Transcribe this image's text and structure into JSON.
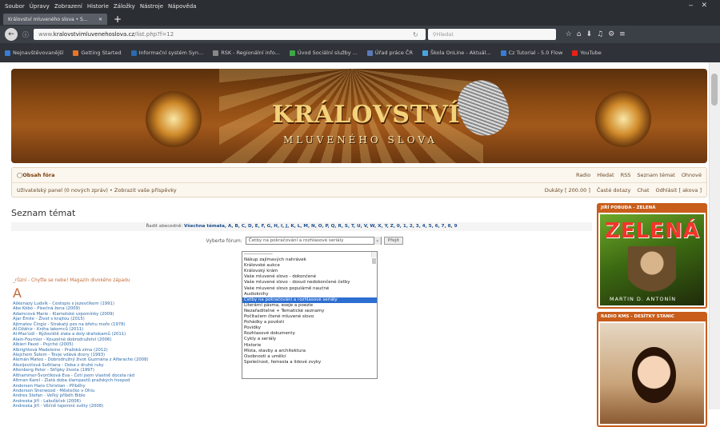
{
  "menubar": [
    "Soubor",
    "Úpravy",
    "Zobrazení",
    "Historie",
    "Záložky",
    "Nástroje",
    "Nápověda"
  ],
  "tab": {
    "title": "Království mluveného slova • S...",
    "close": "✕"
  },
  "newtab": "+",
  "url": {
    "prefix": "www.",
    "domain": "kralovstvimluvenehoslova.cz",
    "path": "/list.php?f=12"
  },
  "search_placeholder": "Hledat",
  "bookmarks": [
    {
      "label": "Nejnavštěvovanější",
      "color": "#3a7bd5"
    },
    {
      "label": "Getting Started",
      "color": "#e8742a"
    },
    {
      "label": "Informační systém Syn...",
      "color": "#2d6ab0"
    },
    {
      "label": "RSK - Regionální info...",
      "color": "#888888"
    },
    {
      "label": "Úvod Sociální služby ...",
      "color": "#3fa64a"
    },
    {
      "label": "Úřad práce ČR",
      "color": "#5a7ab8"
    },
    {
      "label": "Škola OnLine - Aktuál...",
      "color": "#4aa3e0"
    },
    {
      "label": "Cz Tutorial - 5.0 Flow",
      "color": "#3a7bd5"
    },
    {
      "label": "YouTube",
      "color": "#e62117"
    }
  ],
  "banner": {
    "logo_main": "KRÁLOVSTVÍ",
    "logo_sub": "MLUVENÉHO SLOVA"
  },
  "nav": {
    "contents": "Obsah fóra",
    "right1": [
      "Radio",
      "Hledat",
      "RSS",
      "Seznam témat",
      "Ohnové"
    ],
    "left2": "Uživatelský panel (0 nových zpráv) • Zobrazit vaše příspěvky",
    "right2": [
      "Dukáty [ 200.00 ]",
      "Časté dotazy",
      "Chat",
      "Odhlásit [ akova ]"
    ]
  },
  "page_title": "Seznam témat",
  "alpha": {
    "prefix": "Řadit abecedně:",
    "items": "Všechna témata, A, B, C, D, E, F, G, H, I, J, K, L, M, N, O, P, Q, R, S, T, U, V, W, X, Y, Z, 0, 1, 2, 3, 4, 5, 6, 7, 8, 9"
  },
  "forum_select": {
    "label": "Vyberte fórum:",
    "value": "Četby na pokračování a rozhlasové seriály",
    "button": "Přejít"
  },
  "dropdown_options": [
    "------------------",
    "Nákup zajímavých nahrávek",
    "Královské aukce",
    "Královský krám",
    "Vaše mluvené slovo - dokončené",
    "Vaše mluvené slovo - dosud nedokončené četby",
    "Vaše mluvené slovo populárně naučné",
    "Audioknihy",
    "Četby na pokračování a rozhlasové seriály",
    "Literární pásma, eseje a poezie",
    "Nezařaditelné + Tematické seznamy",
    "Počítačem čtené mluvené slovo",
    "Pohádky a pověsti",
    "Povídky",
    "Rozhlasové dokumenty",
    "Cykly a seriály",
    "Historie",
    "Místa, stavby a architektura",
    "Osobnosti a umělci",
    "Společnost, femesla a lidové zvyky"
  ],
  "selected_index": 8,
  "misc_line": "_různí - Chyťte se nebe! Magazín divokého západu",
  "letter": "A",
  "entries": [
    "Aškenazy Ludvík - Cestopis s jezevčíkem (1991)",
    "Abe Kóbó - Písečná žena (2009)",
    "Adamcová Marie - Klamotské vzpomínky (2009)",
    "Ajar Émile - Život s krajtou (2015)",
    "Ajtmatov Čingiz - Strakatý pes na břehu moře (1978)",
    "Al-Džáhiz - Kniha lakomců (2011)",
    "Al-Mas'údí - Rýžoviště zlata a doly drahokamů (2011)",
    "Alain-Fournier - Kouzelné dobrodružství (2006)",
    "Albieri Pavel - Psýché (2005)",
    "Albrightová Madeleine - Pražská zima (2012)",
    "Alejchem Šolem - Tovje vdává dcery (1993)",
    "Alemán Mateo - Dobrodružný život Guzmána z Alfarache (2008)",
    "Alexijevičová Světlana - Doba z druhé ruky",
    "Altenberg Peter - Střípky života (1997)",
    "Althammer-Švorčíková Eva - Četl jsem vlastně docela rád",
    "Altman Karel - Zlatá doba šlampastů pražských hospod",
    "Andersen Hans Christian - Příběhy",
    "Anderson Sherwood - Městečko v Ohiu",
    "Andres Stefan - Veľký příběh Bible",
    "Andreska Jiří - Labuťáček (2006)",
    "Andreska Jiří - Věčně tajemné světy (2008)"
  ],
  "sidebar": {
    "box1_title": "JIŘÍ POBUDA - ZELENÁ",
    "cover_title": "ZELENÁ",
    "cover_author": "MARTIN D. ANTONÍN",
    "box2_title": "RADIO KMS - DESÍTKY STANIC"
  }
}
